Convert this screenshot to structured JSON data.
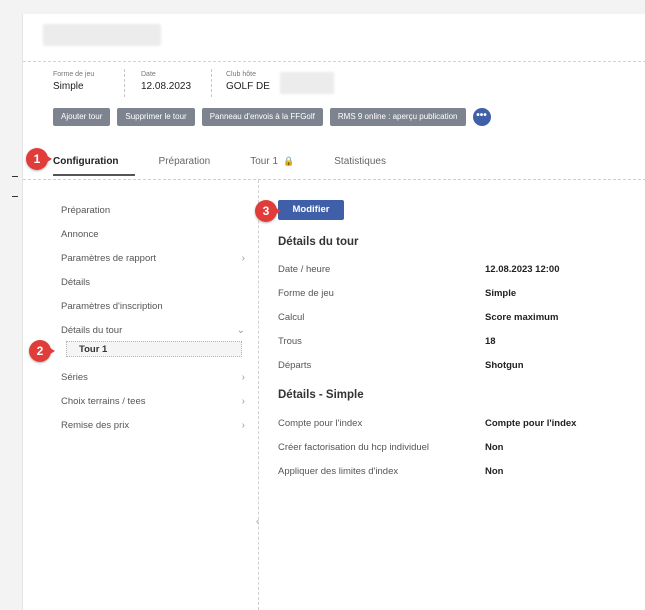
{
  "header": {
    "fields": [
      {
        "label": "Forme de jeu",
        "value": "Simple"
      },
      {
        "label": "Date",
        "value": "12.08.2023"
      },
      {
        "label": "Club hôte",
        "value": "GOLF DE"
      }
    ]
  },
  "actions": [
    {
      "label": "Ajouter tour"
    },
    {
      "label": "Supprimer le tour"
    },
    {
      "label": "Panneau d'envois à la FFGolf"
    },
    {
      "label": "RMS 9 online : aperçu publication"
    }
  ],
  "more_label": "•••",
  "tabs": [
    {
      "label": "Configuration",
      "active": true
    },
    {
      "label": "Préparation"
    },
    {
      "label": "Tour 1",
      "icon": "lock-icon"
    },
    {
      "label": "Statistiques"
    }
  ],
  "sidebar": {
    "items": [
      {
        "label": "Préparation"
      },
      {
        "label": "Annonce"
      },
      {
        "label": "Paramètres de rapport",
        "chevron": "›"
      },
      {
        "label": "Détails"
      },
      {
        "label": "Paramètres d'inscription"
      },
      {
        "label": "Détails du tour",
        "chevron": "⌄"
      }
    ],
    "sub_item": "Tour 1",
    "items_after": [
      {
        "label": "Séries",
        "chevron": "›"
      },
      {
        "label": "Choix terrains / tees",
        "chevron": "›"
      },
      {
        "label": "Remise des prix",
        "chevron": "›"
      }
    ]
  },
  "main": {
    "modify_label": "Modifier",
    "round_title": "Détails du tour",
    "round_rows": [
      {
        "k": "Date / heure",
        "v": "12.08.2023 12:00"
      },
      {
        "k": "Forme de jeu",
        "v": "Simple"
      },
      {
        "k": "Calcul",
        "v": "Score maximum"
      },
      {
        "k": "Trous",
        "v": "18"
      },
      {
        "k": "Départs",
        "v": "Shotgun"
      }
    ],
    "simple_title": "Détails - Simple",
    "simple_rows": [
      {
        "k": "Compte pour l'index",
        "v": "Compte pour l'index"
      },
      {
        "k": "Créer factorisation du hcp individuel",
        "v": "Non"
      },
      {
        "k": "Appliquer des limites d'index",
        "v": "Non"
      }
    ]
  },
  "badges": [
    "1",
    "2",
    "3"
  ],
  "colors": {
    "accent": "#3f5fa8",
    "badge": "#e03d3a",
    "action_button": "#7d8490"
  }
}
